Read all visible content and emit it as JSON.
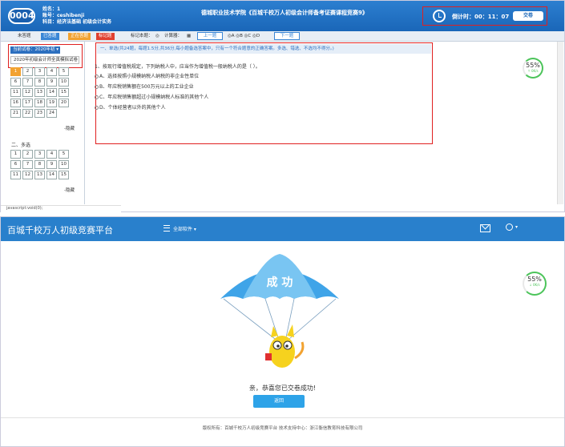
{
  "exam": {
    "header": {
      "logo_number": "0004",
      "name_line": "姓名：1",
      "account_line": "账号：ceshibenji",
      "subject_line": "科目：经济法基础  初级会计实务",
      "title": "德城职业技术学院《百城千校万人初级会计师备考证赛课程竞赛9》",
      "timer": "倒计时：00：11：07",
      "submit_label": "交卷"
    },
    "toolbar": {
      "unanswered": "未答题",
      "answered": "已答题",
      "current": "正在答题",
      "marked": "标记题",
      "mark_label": "标记本题：",
      "calculator_label": "计算器：",
      "prev_label": "上一题",
      "options_label": "◎A ◎B ◎C ◎D",
      "next_label": "下一题"
    },
    "sidebar": {
      "select_label": "当前试卷：2020年初 ▾",
      "selected_item": "2020年初级会计师全真模拟试卷",
      "section1_numbers": [
        "1",
        "2",
        "3",
        "4",
        "5",
        "6",
        "7",
        "8",
        "9",
        "10",
        "11",
        "12",
        "13",
        "14",
        "15",
        "16",
        "17",
        "18",
        "19",
        "20",
        "21",
        "22",
        "23",
        "24"
      ],
      "section1_hide": "-隐藏",
      "section2_label": "二、多选",
      "section2_numbers": [
        "1",
        "2",
        "3",
        "4",
        "5",
        "6",
        "7",
        "8",
        "9",
        "10",
        "11",
        "12",
        "13",
        "14",
        "15"
      ],
      "section2_hide": "-隐藏"
    },
    "question": {
      "header": "一、单选(共24题，每题1.5分,共36分,每小题备选答案中，只有一个符合题意的正确答案。多选、错选、不选均不得分。)",
      "stem": "1、按现行增值税规定，下列纳税人中，应当作为增值税一般纳税人的是（ ）。",
      "options": [
        "A、选择按照小规模纳税人纳税的非企业性单位",
        "B、年应税销售额在500万元以上的工业企业",
        "C、年应税销售额超过小规模纳税人标准的其他个人",
        "D、个体经营者以外的其他个人"
      ]
    },
    "progress": {
      "percent": "55%",
      "speed": "↑ 0K/s"
    },
    "status_bar": "javascript:void(0);"
  },
  "result": {
    "nav": {
      "title": "百城千校万人初级竞赛平台",
      "menu_label": "全部软件 ▾",
      "user_caret": "▾"
    },
    "banner": "成 功",
    "message": "亲，恭喜您已交卷成功!",
    "back_label": "返回",
    "progress": {
      "percent": "55%",
      "speed": "↓ 0K/s"
    },
    "footer": "版权所有：百城千校万人初级竞赛平台      技术支持中心：浙江衡信教育科技有限公司"
  },
  "colors": {
    "primary": "#2980cc",
    "accent_red": "#e02020",
    "current_orange": "#f2a230",
    "progress_green": "#4cc45a",
    "button_blue": "#2ea3e8"
  }
}
